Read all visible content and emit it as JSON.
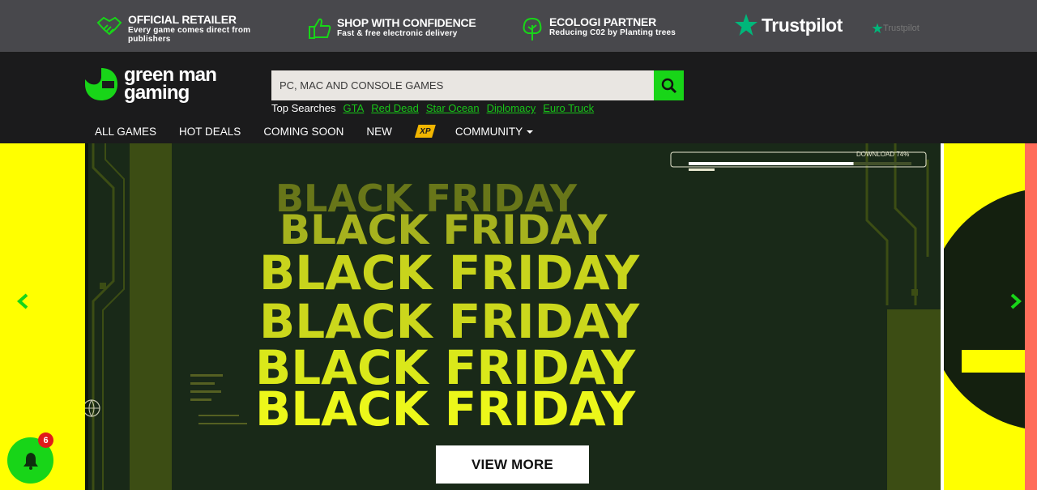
{
  "topbar": {
    "features": [
      {
        "title": "OFFICIAL RETAILER",
        "subtitle": "Every game comes direct from publishers",
        "icon": "handshake-icon"
      },
      {
        "title": "SHOP WITH CONFIDENCE",
        "subtitle": "Fast & free electronic delivery",
        "icon": "thumbs-up-icon"
      },
      {
        "title": "ECOLOGI PARTNER",
        "subtitle": "Reducing C02 by Planting trees",
        "icon": "tree-icon"
      }
    ],
    "trustpilot_main": "Trustpilot",
    "trustpilot_small": "Trustpilot"
  },
  "header": {
    "logo_line1": "green man",
    "logo_line2": "gaming",
    "search": {
      "placeholder": "PC, MAC AND CONSOLE GAMES"
    },
    "top_searches_label": "Top Searches",
    "top_searches": [
      "GTA",
      "Red Dead",
      "Star Ocean",
      "Diplomacy",
      "Euro Truck"
    ],
    "nav": [
      "ALL GAMES",
      "HOT DEALS",
      "COMING SOON",
      "NEW",
      "XP",
      "COMMUNITY"
    ]
  },
  "hero": {
    "headline_lines": [
      "BLACK FRIDAY",
      "BLACK FRIDAY",
      "BLACK FRIDAY",
      "BLACK FRIDAY",
      "BLACK FRIDAY",
      "BLACK FRIDAY"
    ],
    "download_text": "DOWNLOAD 74%",
    "download_progress": 0.74,
    "cta": "VIEW MORE"
  },
  "notifications": {
    "count": "6"
  },
  "colors": {
    "brand_green": "#18d518",
    "hero_yellow": "#ffff00",
    "slide_bg": "#192918",
    "text_yellow": "#d8e81a",
    "accent_red": "#ff6d5a"
  }
}
